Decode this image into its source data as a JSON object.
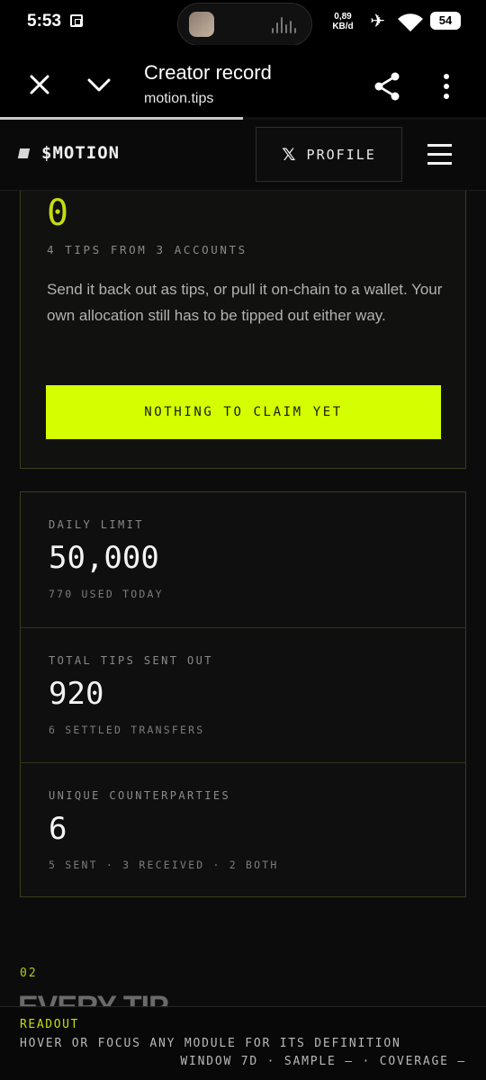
{
  "status_bar": {
    "time": "5:53",
    "net_speed_value": "0,89",
    "net_speed_unit": "KB/d",
    "battery": "54"
  },
  "browser": {
    "title": "Creator record",
    "url": "motion.tips",
    "load_progress_percent": 50,
    "icons": [
      "close-icon",
      "chevron-down-icon",
      "share-icon",
      "more-vert-icon"
    ]
  },
  "site_nav": {
    "brand": "$MOTION",
    "profile_glyph": "𝕏",
    "profile_label": "PROFILE"
  },
  "claim": {
    "amount": "0",
    "subtitle": "4 TIPS FROM 3 ACCOUNTS",
    "body": "Send it back out as tips, or pull it on-chain to a wallet. Your own allocation still has to be tipped out either way.",
    "button": "NOTHING TO CLAIM YET",
    "accent": "#d5ff00"
  },
  "stats": [
    {
      "label": "DAILY LIMIT",
      "value": "50,000",
      "sub": "770 USED TODAY"
    },
    {
      "label": "TOTAL TIPS SENT OUT",
      "value": "920",
      "sub": "6 SETTLED TRANSFERS"
    },
    {
      "label": "UNIQUE COUNTERPARTIES",
      "value": "6",
      "sub": "5 SENT · 3 RECEIVED · 2 BOTH"
    }
  ],
  "section": {
    "number": "02",
    "title": "EVERY TIP"
  },
  "readout": {
    "title": "READOUT",
    "hint": "HOVER OR FOCUS ANY MODULE FOR ITS DEFINITION",
    "meta": "WINDOW 7D · SAMPLE — · COVERAGE —"
  }
}
